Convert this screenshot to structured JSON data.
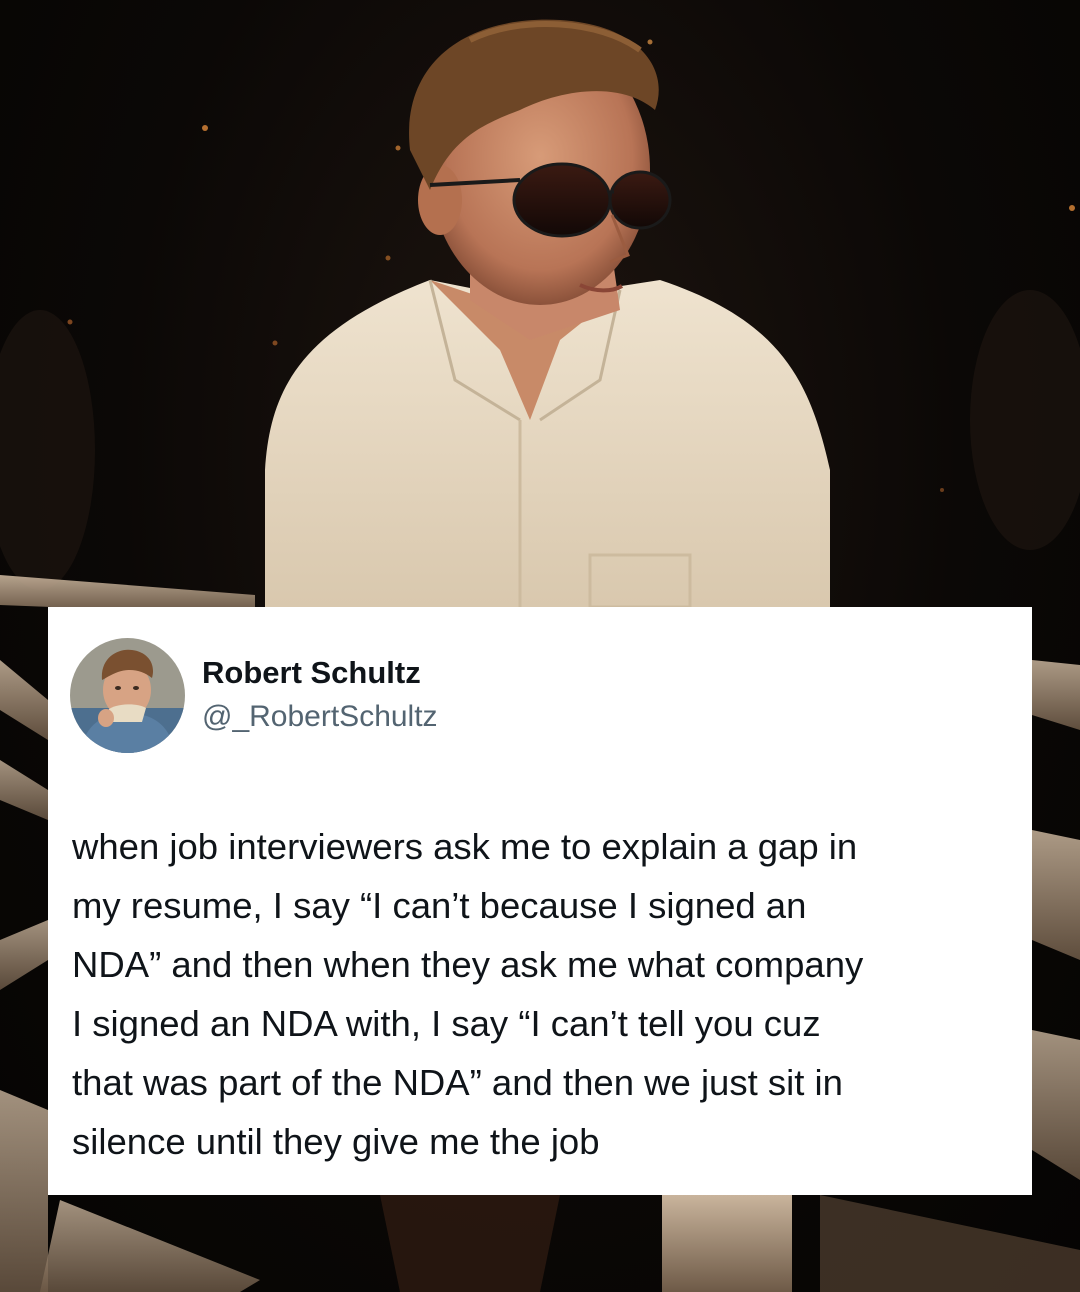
{
  "tweet": {
    "display_name": "Robert Schultz",
    "handle": "@_RobertSchultz",
    "text_lines": [
      "when job interviewers ask me to explain a gap in",
      "my resume, I say “I can’t because I signed an",
      "NDA” and then when they ask me what company",
      "I signed an NDA with, I say “I can’t tell you cuz",
      "that was part of the NDA” and then we just sit in",
      "silence until they give me the job"
    ]
  },
  "colors": {
    "card_background": "#ffffff",
    "name_color": "#0f1419",
    "handle_color": "#536471",
    "text_color": "#0f1419"
  }
}
